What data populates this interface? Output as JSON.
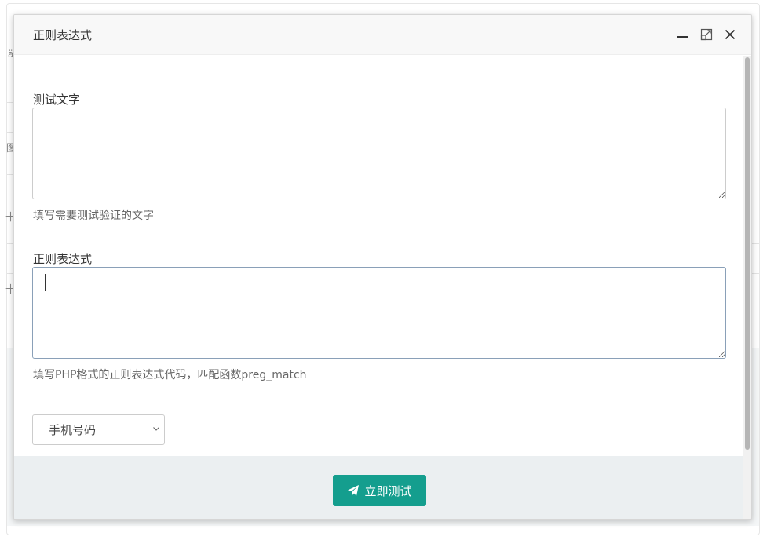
{
  "background": {
    "fragments": [
      "ä",
      "图",
      "十",
      "十"
    ]
  },
  "modal": {
    "title": "正则表达式",
    "controls": [
      "minimize-icon",
      "maximize-icon",
      "close-icon"
    ],
    "test_text": {
      "label": "测试文字",
      "value": "",
      "help": "填写需要测试验证的文字"
    },
    "regex": {
      "label": "正则表达式",
      "value": "",
      "help": "填写PHP格式的正则表达式代码，匹配函数preg_match"
    },
    "preset": {
      "selected": "手机号码"
    },
    "submit": {
      "label": "立即测试",
      "icon": "paper-plane-icon",
      "color": "#149e8e"
    }
  }
}
